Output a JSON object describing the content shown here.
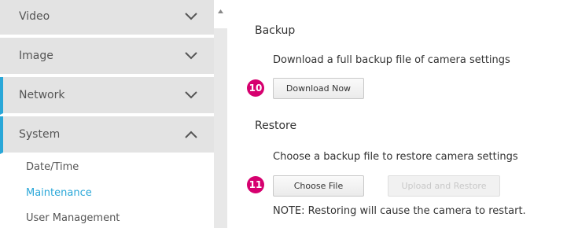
{
  "sidebar": {
    "items": [
      {
        "label": "Video",
        "expanded": false
      },
      {
        "label": "Image",
        "expanded": false
      },
      {
        "label": "Network",
        "expanded": false
      },
      {
        "label": "System",
        "expanded": true
      }
    ],
    "sub_items": [
      "Date/Time",
      "Maintenance",
      "User Management"
    ],
    "current_sub_item": "Maintenance"
  },
  "backup": {
    "title": "Backup",
    "description": "Download a full backup file of camera settings",
    "marker": "10",
    "download_label": "Download Now"
  },
  "restore": {
    "title": "Restore",
    "description": "Choose a backup file to restore camera settings",
    "marker": "11",
    "choose_label": "Choose File",
    "upload_label": "Upload and Restore",
    "note": "NOTE: Restoring will cause the camera to restart."
  },
  "colors": {
    "accent": "#2aa7d8",
    "marker": "#d6006f",
    "nav_bg": "#e3e3e3"
  }
}
